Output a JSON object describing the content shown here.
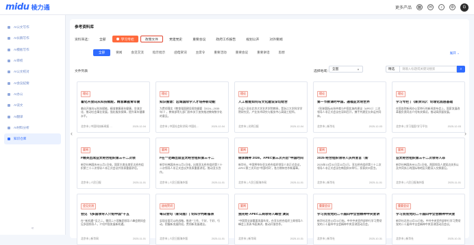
{
  "brand": {
    "logo": "midu",
    "name": "棱力通"
  },
  "topbar": {
    "more_products": "更多产品",
    "user_initial": "G"
  },
  "sidebar": {
    "items": [
      {
        "label": "AI公文写作",
        "active": false
      },
      {
        "label": "AI长稿写作",
        "active": false
      },
      {
        "label": "AI模板写作",
        "active": false
      },
      {
        "label": "AI审校",
        "active": false
      },
      {
        "label": "AI公文校对",
        "active": false
      },
      {
        "label": "AI会议纪要",
        "active": false
      },
      {
        "label": "AI办公",
        "active": false
      },
      {
        "label": "AI读文",
        "active": false
      },
      {
        "label": "AI翻译",
        "active": false
      },
      {
        "label": "AI材料分析",
        "active": false
      },
      {
        "label": "知识仓库",
        "active": true
      }
    ],
    "collapse_icon": "«"
  },
  "main": {
    "title": "参考资料库",
    "filter_label": "资料筛选：",
    "filters": [
      "全部",
      "学习专栏",
      "政策文件",
      "党建党史",
      "重要会议",
      "政府工作报告",
      "规划公开",
      "对外要闻"
    ],
    "categories": [
      "全部",
      "要闻",
      "会见交流",
      "指示批示",
      "函电贺词",
      "主席令",
      "重要活动",
      "重要会议",
      "重要讲话",
      "思想"
    ],
    "expand": "展开",
    "list_label": "文件列表",
    "region_label": "选择地域：",
    "region_value": "全国",
    "search_type": "精选",
    "search_placeholder": "请输入标题或关键词搜索"
  },
  "cards": [
    {
      "badge": "理论",
      "title": "着化开放向从科技赋能，精准掌握青年健",
      "body": "着化开放向从科技赋能，精准掌握青年健康，交流文化、推动社会事业发展，强化服务保障，提升青年健康水平。",
      "source": "北京市 | 中国科技新闻报 …",
      "date": "2025-12-04"
    },
    {
      "badge": "理论",
      "title": "知识图谱：区域国际学人才培养新动能",
      "body": "为贯彻落实《教育强国建设规划纲要（2024—2035年）》，教育部等九部门发布关于加快推进教育数字化的意见。",
      "source": "北京市 | 中国社会科学网-中国社…",
      "date": "2025-12-04"
    },
    {
      "badge": "理论",
      "title": "人工智能如何与文化建设深切结合",
      "body": "在运人员在北京大学艺术学院教授，是浙江大学科学学院研究员，产业技术研究与服务中心高级工程师。",
      "source": "北京市 | 光明日报",
      "date": "2025-12-04"
    },
    {
      "badge": "理论",
      "title": "第一节数课时中国，通福亚太明世界",
      "body": "《形制国际纠纷仲裁与中国实施的建议（APEC）二次领导人非正式会议在深圳召开，携手共建亚太命运共同体。",
      "source": "北京市 | 新华社",
      "date": "2025-12-03"
    },
    {
      "badge": "理论",
      "title": "学习专栏 | 《新资讯》：论理化底层基础",
      "body": "在国务院新闻办公室举行的新闻发布会上，国家发展改革委负责同志介绍有关情况，推动高质量发展。",
      "source": "北京市 | 学习强国“学习平台",
      "date": "2025-12-03"
    },
    {
      "badge": "要闻",
      "title": "F精英出席亚太经合组织第三十二次领",
      "body": "新华社韩国庆州11月1日电，国家主席出席亚太经合组织第三十二次领导人非正式会议并发表重要讲话。",
      "source": "北京市 | 人民日报",
      "date": "2025-11-01"
    },
    {
      "badge": "要闻",
      "title": "F在“”范畴出席亚太经合组织第三十二",
      "body": "新华社韩国庆州11月1日电，出席亚太经合组织第三十二次领导人非正式会议并发表重要讲话，推动亚太合作。",
      "source": "北京市 | 人民日报海外版",
      "date": "2025-11-01"
    },
    {
      "badge": "要闻",
      "title": "继承精神 2026，APEC第三次开启“中国时间”",
      "body": "新华社，中国将举办亚太经合组织领导人非正式会议，APEC第三次开启“中国时间”，各方期待合作新篇章。",
      "source": "北京市 | 人民日报海外网",
      "date": "2025-11-01"
    },
    {
      "badge": "要闻",
      "title": "2025·经合组织领导人庆州宣言（新",
      "body": "2025年10月31日至11月1日，亚太经合组织第三十二次领导人非正式会议在韩国庆州举行，发表庆州宣言。",
      "source": "北京市 | 新华社",
      "date": "2025-11-01"
    },
    {
      "badge": "要闻",
      "title": "亚太经合组织第三十二次领导人非",
      "body": "新华社韩国庆州11月1日电，两国领导人就双边关系以及共同关心的国际和地区问题深入交换意见。",
      "source": "北京市 | 人民日报海外版",
      "date": "2025-11-01"
    },
    {
      "badge": "会见交流",
      "title": "会见 飞多国领导人介绍中国“十五",
      "body": "在“”新机遇“”见之二，雷同二十国集团领导人峰会期间会见多国领导人，介绍中国发展新机遇。",
      "source": "北京市 | 新华网",
      "date": "2025-11-01"
    },
    {
      "badge": "函电贺词",
      "title": "每日金句（新词版）| 论科学判断备表",
      "body": "实现全面可以的战略，推进“”工作、干好、干好、行动，把握新发展阶段，贯彻新发展理念。",
      "source": "北京市 | 人民日报海外版",
      "date": "2025-11-01"
    },
    {
      "badge": "要闻",
      "title": "独光经·APEC工商领导人峰会 演说",
      "body": "“中国是全球重要发展伙伴，在亚太经合组织工商领导人峰会上发表书面演讲，推动开放合作。",
      "source": "北京市 | 新华网",
      "date": "2025-10-31"
    },
    {
      "badge": "重要会议",
      "title": "学习贯彻党的二十届四中全会精神中央宣讲",
      "body": "新华社北京10月31日电，中共中央宣传部举行学习贯彻党的二十届四中全会精神中央宣讲团动员会。",
      "source": "北京市 | 新华社",
      "date": "2025-10-31"
    },
    {
      "badge": "重要会议",
      "title": "学习贯彻党的二十届四中全会精神中央宣",
      "body": "新华社北京10月31日电，中共中央宣传部举行学习贯彻党的二十届四中全会精神中央宣讲团动员会议。",
      "source": "北京市 | 新华社",
      "date": "2025-10-31"
    }
  ]
}
